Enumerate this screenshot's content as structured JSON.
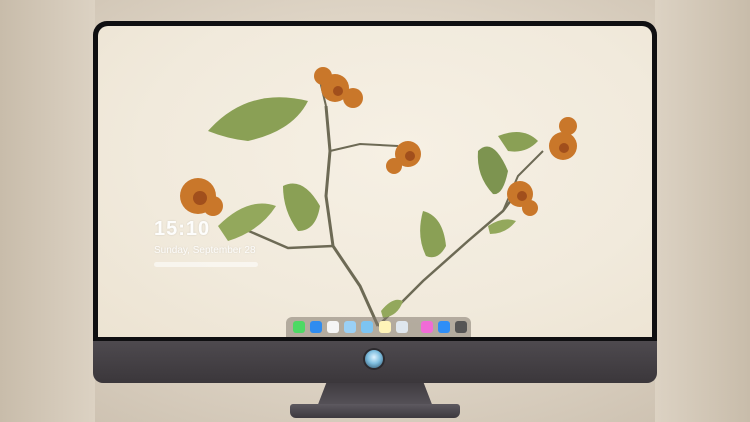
{
  "lock_screen": {
    "time": "15:10",
    "date": "Sunday, September 28"
  },
  "dock": {
    "items": [
      {
        "name": "messages-icon",
        "color": "#4cd964"
      },
      {
        "name": "finder-icon",
        "color": "#2f8cf0"
      },
      {
        "name": "safari-icon",
        "color": "#f5f5f5"
      },
      {
        "name": "mail-icon",
        "color": "#9ad0f5"
      },
      {
        "name": "photos-icon",
        "color": "#7dc4f2"
      },
      {
        "name": "notes-icon",
        "color": "#fff4b8"
      },
      {
        "name": "preview-icon",
        "color": "#dfe7ee"
      },
      {
        "name": "itunes-icon",
        "color": "#f06bd6"
      },
      {
        "name": "app-store-icon",
        "color": "#2e8ef7"
      },
      {
        "name": "camera-icon",
        "color": "#555555"
      }
    ]
  },
  "monitor": {
    "logo": "apple-logo-icon"
  }
}
